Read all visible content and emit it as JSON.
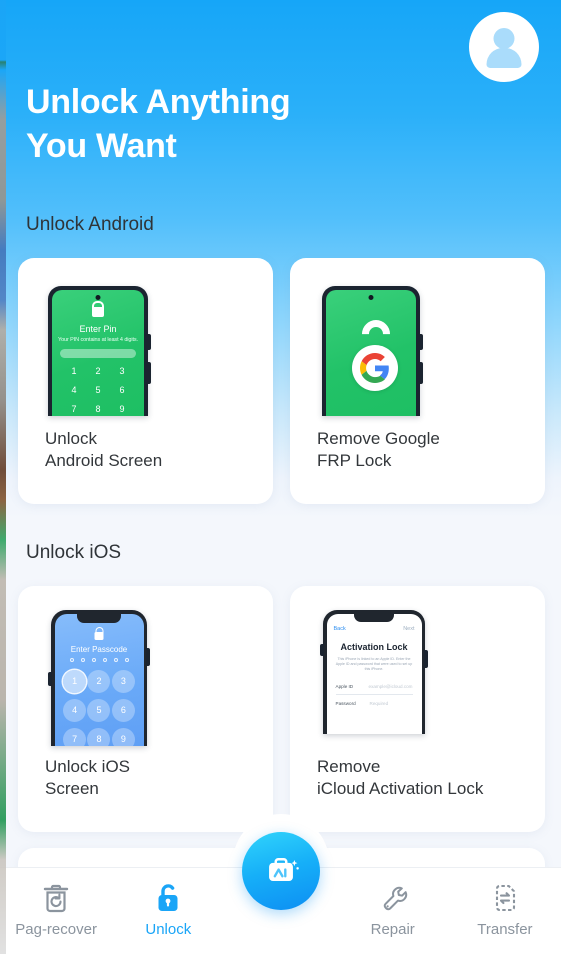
{
  "hero": {
    "title": "Unlock Anything\nYou Want",
    "avatar_icon": "user-avatar-icon"
  },
  "sections": [
    {
      "id": "android",
      "title": "Unlock Android"
    },
    {
      "id": "ios",
      "title": "Unlock iOS"
    }
  ],
  "cards": {
    "unlock_android": {
      "label": "Unlock\nAndroid Screen",
      "art": {
        "type": "android-pin-phone",
        "lock_icon": "lock-icon",
        "heading": "Enter Pin",
        "subtext": "Your PIN contains at least 4 digits.",
        "keys": [
          "1",
          "2",
          "3",
          "4",
          "5",
          "6",
          "7",
          "8",
          "9"
        ]
      }
    },
    "remove_frp": {
      "label": "Remove Google\nFRP Lock",
      "art": {
        "type": "android-frp-phone",
        "lock_icon": "open-padlock-icon",
        "brand_icon": "google-g-icon"
      }
    },
    "unlock_ios": {
      "label": "Unlock iOS\nScreen",
      "art": {
        "type": "ios-passcode-phone",
        "lock_icon": "lock-icon",
        "heading": "Enter Passcode",
        "dots": 6,
        "keys": [
          "1",
          "2",
          "3",
          "4",
          "5",
          "6",
          "7",
          "8",
          "9"
        ]
      }
    },
    "remove_icloud": {
      "label": "Remove\niCloud Activation Lock",
      "art": {
        "type": "ios-activation-lock-phone",
        "back_label": "Back",
        "next_label": "Next",
        "title": "Activation Lock",
        "body": "This iPhone is linked to an Apple ID. Enter the Apple ID and password that were used to set up this iPhone.",
        "fields": [
          {
            "key": "Apple ID",
            "placeholder": "example@icloud.com"
          },
          {
            "key": "Password",
            "placeholder": "Required"
          }
        ]
      }
    }
  },
  "tabbar": {
    "items": [
      {
        "label": "Pag-recover",
        "icon": "trash-restore-icon",
        "active": false
      },
      {
        "label": "Unlock",
        "icon": "padlock-open-icon",
        "active": true
      },
      {
        "label": "",
        "icon": "ai-toolbox-icon",
        "active": false
      },
      {
        "label": "Repair",
        "icon": "wrench-icon",
        "active": false
      },
      {
        "label": "Transfer",
        "icon": "transfer-document-icon",
        "active": false
      }
    ]
  },
  "colors": {
    "accent": "#1aa5f7",
    "hero_top": "#16a6f8",
    "page_bg": "#f4f7fc",
    "android_green": "#22c268",
    "ios_blue": "#6aaaf8",
    "tab_inactive": "#8b949e"
  }
}
